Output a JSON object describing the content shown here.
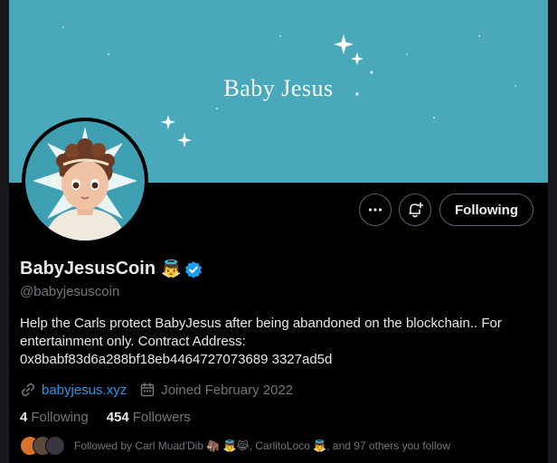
{
  "banner": {
    "title": "Baby Jesus",
    "background_color": "#49a9ba"
  },
  "actions": {
    "more_icon": "more-horizontal-icon",
    "notify_icon": "bell-plus-icon",
    "following_label": "Following"
  },
  "profile": {
    "display_name": "BabyJesusCoin",
    "name_emoji": "👼",
    "verified": true,
    "handle": "@babyjesuscoin",
    "bio_lines": [
      "Help the Carls protect BabyJesus after being abandoned on the blockchain.. For",
      "entertainment only. Contract Address:",
      "0x8babf83d6a288bf18eb4464727073689 3327ad5d"
    ],
    "website": "babyjesus.xyz",
    "joined": "Joined February 2022"
  },
  "stats": {
    "following_count": "4",
    "following_label": "Following",
    "followers_count": "454",
    "followers_label": "Followers"
  },
  "followed_by": {
    "text": "Followed by Carl Muad'Dib 🦣 👼😹, CarlitoLoco 👼, and 97 others you follow"
  },
  "colors": {
    "accent": "#1d9bf0",
    "muted_text": "#71767b",
    "primary_text": "#e7e9ea",
    "border": "#536471"
  }
}
